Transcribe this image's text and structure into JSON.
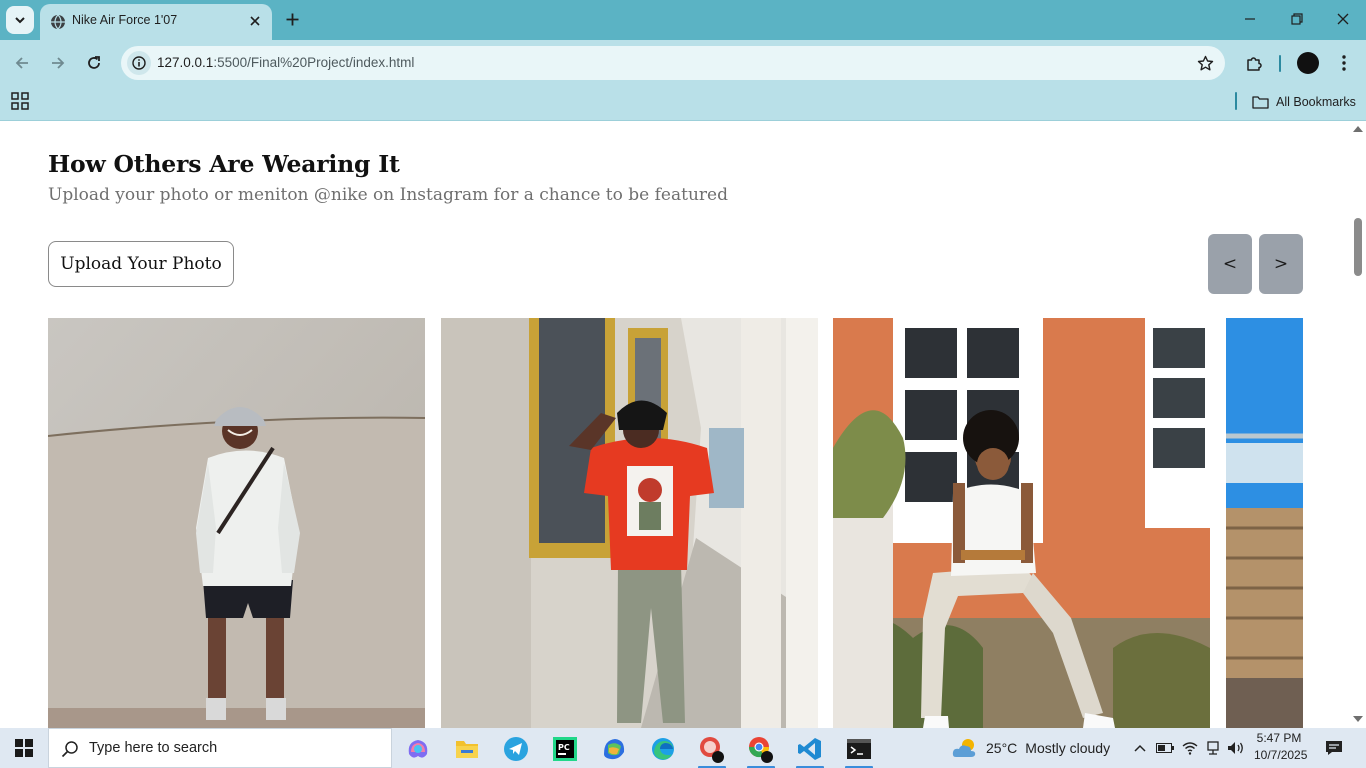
{
  "browser": {
    "tab_title": "Nike Air Force 1'07",
    "url_host": "127.0.0.1",
    "url_path": ":5500/Final%20Project/index.html",
    "all_bookmarks": "All Bookmarks"
  },
  "page": {
    "title": "How Others Are Wearing It",
    "subtitle": "Upload your photo or meniton @nike on Instagram for a chance to be featured",
    "upload_button": "Upload Your Photo",
    "prev_button": "<",
    "next_button": ">",
    "gallery": [
      {
        "scene": "man in bucket hat and white sweatshirt against beige wall"
      },
      {
        "scene": "man in red t-shirt on tiled balcony with gold window frames"
      },
      {
        "scene": "man seated in white tank top beside orange wall"
      },
      {
        "scene": "partially visible blue sky with wooden structure"
      }
    ]
  },
  "taskbar": {
    "search_placeholder": "Type here to search",
    "weather_temp": "25°C",
    "weather_desc": "Mostly cloudy",
    "time": "5:47 PM",
    "date": "10/7/2025"
  },
  "colors": {
    "tabbar": "#5bb3c4",
    "toolbar": "#b9e0e8",
    "nav_button": "#9aa1aa",
    "taskbar": "#dfe8f2"
  }
}
